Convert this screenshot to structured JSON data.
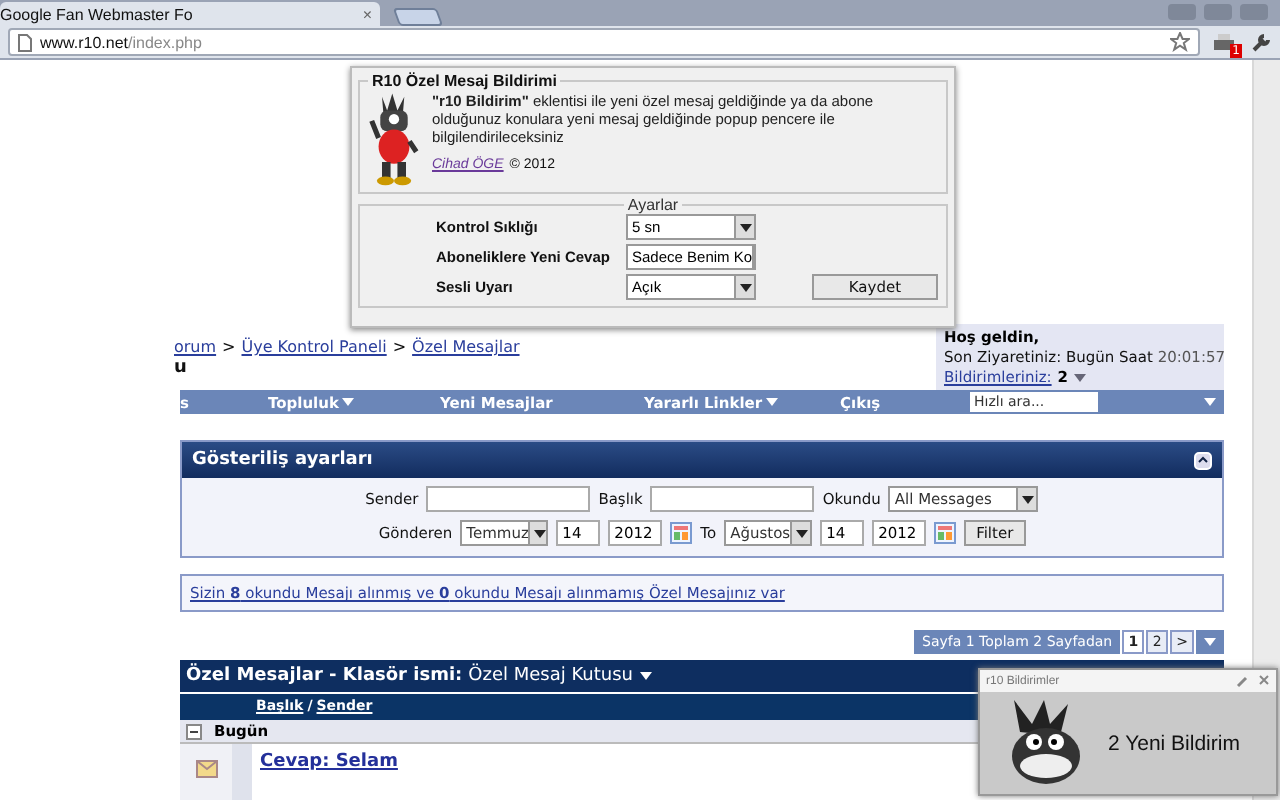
{
  "browser": {
    "tab_title": "Google Fan Webmaster Fo",
    "tab_close": "×",
    "url_host": "www.r10.net",
    "url_path": "/index.php",
    "extension_badge": "1"
  },
  "header": {
    "breadcrumb": [
      "orum",
      "Üye Kontrol Paneli",
      "Özel Mesajlar"
    ],
    "separator": ">",
    "title": "u"
  },
  "welcome": {
    "greeting": "Hoş geldin,",
    "last_visit_label": "Son Ziyaretiniz: Bugün Saat",
    "last_visit_time": "20:01:57",
    "notifications_label": "Bildirimleriniz:",
    "notifications_count": "2"
  },
  "navbar": {
    "items": [
      {
        "label": "s",
        "has_menu": false
      },
      {
        "label": "Topluluk",
        "has_menu": true
      },
      {
        "label": "Yeni Mesajlar",
        "has_menu": false
      },
      {
        "label": "Yararlı Linkler",
        "has_menu": true
      },
      {
        "label": "Çıkış",
        "has_menu": false
      }
    ],
    "search_placeholder": "Hızlı ara..."
  },
  "filter_panel": {
    "title": "Gösteriliş ayarları",
    "sender_label": "Sender",
    "title_label": "Başlık",
    "read_label": "Okundu",
    "read_value": "All Messages",
    "from_label": "Gönderen",
    "from_month": "Temmuz",
    "from_day": "14",
    "from_year": "2012",
    "to_label": "To",
    "to_month": "Ağustos",
    "to_day": "14",
    "to_year": "2012",
    "button": "Filter"
  },
  "info_link": "Sizin **8** okundu Mesajı alınmış ve **0** okundu Mesajı alınmamış Özel Mesajınız var",
  "pagination": {
    "label": "Sayfa 1 Toplam 2 Sayfadan",
    "pages": [
      {
        "label": "1",
        "selected": true
      },
      {
        "label": "2",
        "selected": false
      }
    ],
    "next": ">"
  },
  "messages": {
    "title": "Özel Mesajlar - Klasör ismi:",
    "folder": "Özel Mesaj Kutusu",
    "column_title": "Başlık",
    "column_separator": "/",
    "column_sender": "Sender",
    "group": "Bugün",
    "rows": [
      {
        "title": "Cevap: Selam"
      }
    ]
  },
  "popup": {
    "title": "R10 Özel Mesaj Bildirimi",
    "description": "**\"r10 Bildirim\"** eklentisi ile yeni özel mesaj geldiğinde ya da abone olduğunuz konulara yeni mesaj geldiğinde popup pencere ile bilgilendirileceksiniz",
    "author": "Cihad ÖGE",
    "copyright": "© 2012",
    "settings_title": "Ayarlar",
    "settings": [
      {
        "label": "Kontrol Sıklığı",
        "value": "5 sn"
      },
      {
        "label": "Aboneliklere Yeni Cevap",
        "value": "Sadece Benim Ko"
      },
      {
        "label": "Sesli Uyarı",
        "value": "Açık"
      }
    ],
    "save_button": "Kaydet"
  },
  "notification": {
    "title": "r10 Bildirimler",
    "text": "2 Yeni Bildirim"
  }
}
